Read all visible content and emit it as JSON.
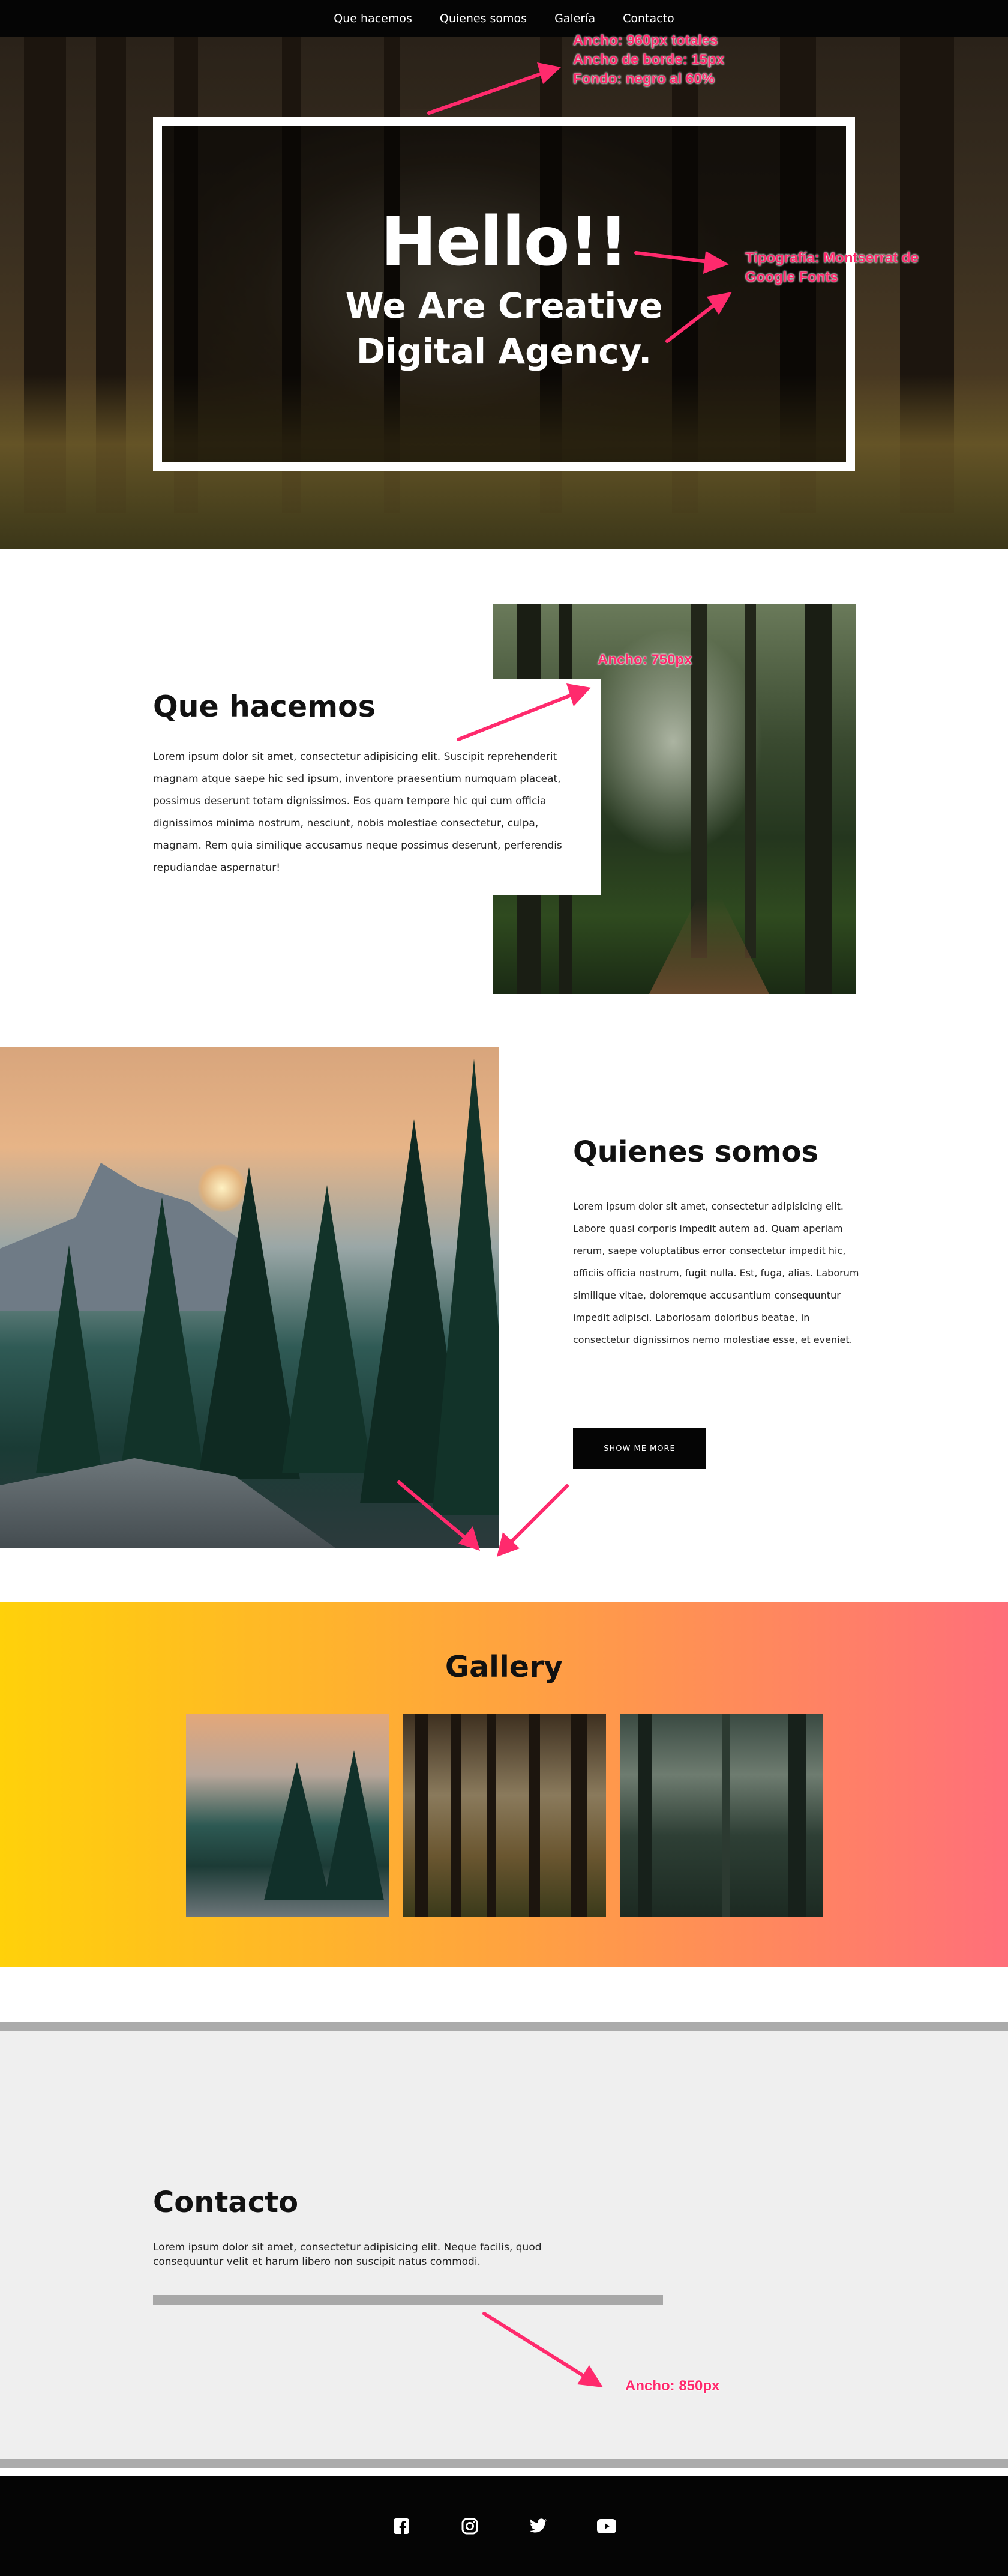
{
  "nav": {
    "items": [
      "Que hacemos",
      "Quienes somos",
      "Galería",
      "Contacto"
    ]
  },
  "hero": {
    "title": "Hello!!",
    "subtitle_line1": "We Are Creative",
    "subtitle_line2": "Digital Agency."
  },
  "annotations": {
    "hero_box": [
      "Ancho: 960px totales",
      "Ancho de borde: 15px",
      "Fondo: negro al 60%"
    ],
    "typography": [
      "Tipografía: Montserrat de",
      "Google Fonts"
    ],
    "que_image": "Ancho: 750px",
    "contact_width": "Ancho: 850px"
  },
  "que_hacemos": {
    "title": "Que hacemos",
    "text": "Lorem ipsum dolor sit amet, consectetur adipisicing elit. Suscipit reprehenderit magnam atque saepe hic sed ipsum, inventore praesentium numquam placeat, possimus deserunt totam dignissimos. Eos quam tempore hic qui cum officia dignissimos minima nostrum, nesciunt, nobis molestiae consectetur, culpa, magnam. Rem quia similique accusamus neque possimus deserunt, perferendis repudiandae aspernatur!"
  },
  "quienes_somos": {
    "title": "Quienes somos",
    "text": "Lorem ipsum dolor sit amet, consectetur adipisicing elit. Labore quasi corporis impedit autem ad. Quam aperiam rerum, saepe voluptatibus error consectetur impedit hic, officiis officia nostrum, fugit nulla. Est, fuga, alias. Laborum similique vitae, doloremque accusantium consequuntur impedit adipisci. Laboriosam doloribus beatae, in consectetur dignissimos nemo molestiae esse, et eveniet.",
    "button_label": "SHOW ME MORE"
  },
  "gallery": {
    "title": "Gallery"
  },
  "contacto": {
    "title": "Contacto",
    "text": "Lorem ipsum dolor sit amet, consectetur adipisicing elit. Neque facilis, quod consequuntur velit et harum libero non suscipit natus commodi."
  },
  "footer": {
    "icons": [
      "facebook-icon",
      "instagram-icon",
      "twitter-icon",
      "youtube-icon"
    ]
  },
  "colors": {
    "annotation": "#ff2a6d",
    "nav_bg": "#050505",
    "gallery_gradient": [
      "#ffd10a",
      "#ffa33f",
      "#ff6f7a"
    ]
  }
}
